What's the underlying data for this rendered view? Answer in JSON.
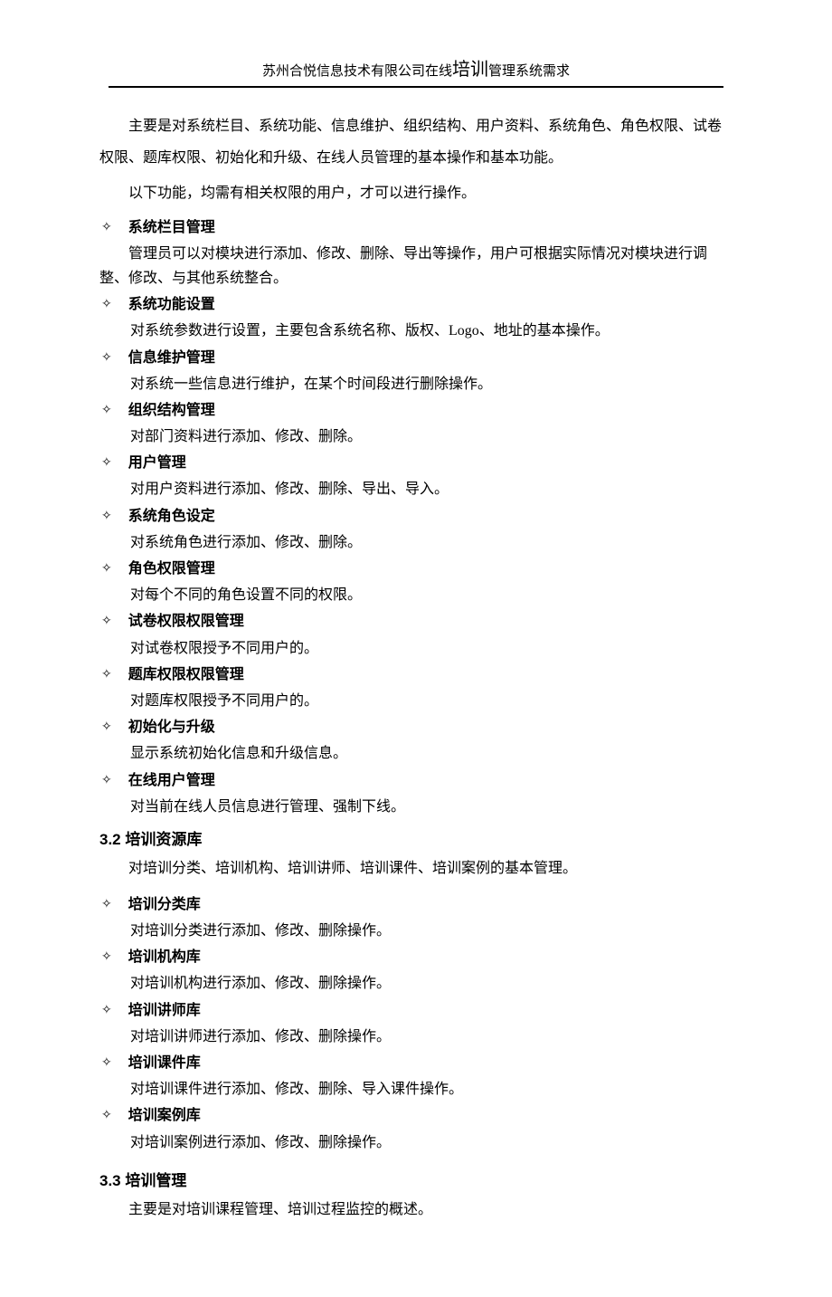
{
  "header": {
    "prefix": "苏州合悦信息技术有限公司在线",
    "emph": "培训",
    "suffix": "管理系统需求"
  },
  "intro_p1": "主要是对系统栏目、系统功能、信息维护、组织结构、用户资料、系统角色、角色权限、试卷权限、题库权限、初始化和升级、在线人员管理的基本操作和基本功能。",
  "intro_p2": "以下功能，均需有相关权限的用户，才可以进行操作。",
  "sec1_items": [
    {
      "title": "系统栏目管理",
      "desc": "管理员可以对模块进行添加、修改、删除、导出等操作，用户可根据实际情况对模块进行调整、修改、与其他系统整合。",
      "flat": true
    },
    {
      "title": "系统功能设置",
      "desc": "对系统参数进行设置，主要包含系统名称、版权、Logo、地址的基本操作。"
    },
    {
      "title": "信息维护管理",
      "desc": "对系统一些信息进行维护，在某个时间段进行删除操作。"
    },
    {
      "title": "组织结构管理",
      "desc": "对部门资料进行添加、修改、删除。"
    },
    {
      "title": "用户管理",
      "desc": "对用户资料进行添加、修改、删除、导出、导入。"
    },
    {
      "title": "系统角色设定",
      "desc": "对系统角色进行添加、修改、删除。"
    },
    {
      "title": "角色权限管理",
      "desc": "对每个不同的角色设置不同的权限。"
    },
    {
      "title": "试卷权限权限管理",
      "desc": "对试卷权限授予不同用户的。"
    },
    {
      "title": "题库权限权限管理",
      "desc": "对题库权限授予不同用户的。"
    },
    {
      "title": "初始化与升级",
      "desc": "显示系统初始化信息和升级信息。"
    },
    {
      "title": "在线用户管理",
      "desc": "对当前在线人员信息进行管理、强制下线。"
    }
  ],
  "sec32_title": "3.2 培训资源库",
  "sec32_intro": "对培训分类、培训机构、培训讲师、培训课件、培训案例的基本管理。",
  "sec2_items": [
    {
      "title": "培训分类库",
      "desc": "对培训分类进行添加、修改、删除操作。"
    },
    {
      "title": "培训机构库",
      "desc": "对培训机构进行添加、修改、删除操作。"
    },
    {
      "title": "培训讲师库",
      "desc": "对培训讲师进行添加、修改、删除操作。"
    },
    {
      "title": "培训课件库",
      "desc": "对培训课件进行添加、修改、删除、导入课件操作。"
    },
    {
      "title": "培训案例库",
      "desc": "对培训案例进行添加、修改、删除操作。"
    }
  ],
  "sec33_title": "3.3 培训管理",
  "sec33_intro": "主要是对培训课程管理、培训过程监控的概述。",
  "diamond": "✧"
}
